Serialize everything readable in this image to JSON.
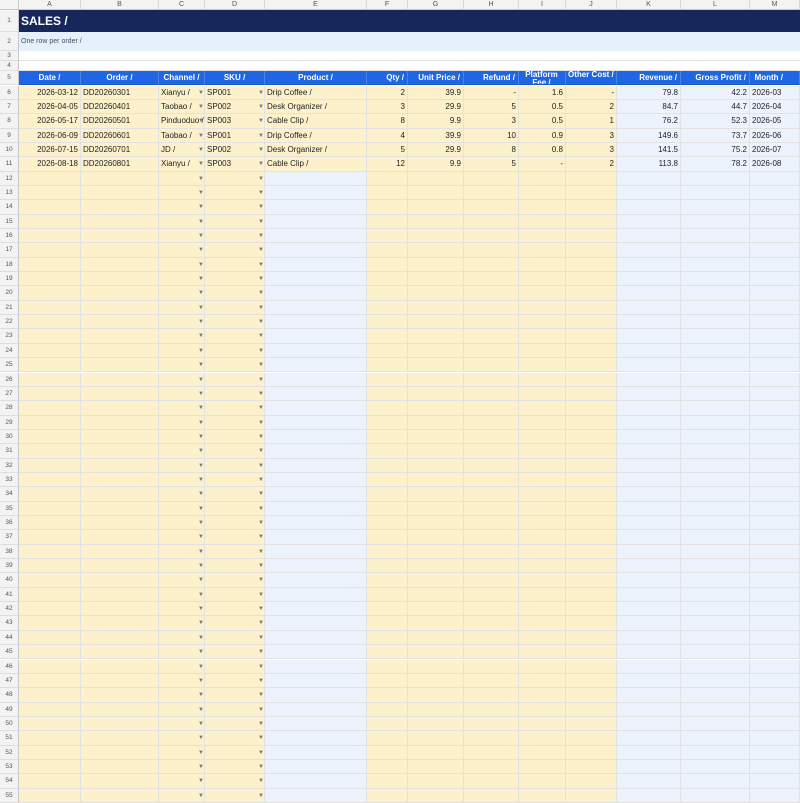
{
  "columns": [
    "A",
    "B",
    "C",
    "D",
    "E",
    "F",
    "G",
    "H",
    "I",
    "J",
    "K",
    "L",
    "M"
  ],
  "title": "SALES /",
  "subtitle": "One row per order /",
  "headers": [
    "Date /",
    "Order /",
    "Channel /",
    "SKU /",
    "Product /",
    "Qty /",
    "Unit Price /",
    "Refund /",
    "Platform Fee /",
    "Other Cost /",
    "Revenue /",
    "Gross Profit /",
    "Month /"
  ],
  "rows": [
    [
      "2026-03-12",
      "DD20260301",
      "Xianyu /",
      "SP001",
      "Drip Coffee /",
      "2",
      "39.9",
      "-",
      "1.6",
      "-",
      "79.8",
      "42.2",
      "2026-03"
    ],
    [
      "2026-04-05",
      "DD20260401",
      "Taobao /",
      "SP002",
      "Desk Organizer /",
      "3",
      "29.9",
      "5",
      "0.5",
      "2",
      "84.7",
      "44.7",
      "2026-04"
    ],
    [
      "2026-05-17",
      "DD20260501",
      "Pinduoduo /",
      "SP003",
      "Cable Clip /",
      "8",
      "9.9",
      "3",
      "0.5",
      "1",
      "76.2",
      "52.3",
      "2026-05"
    ],
    [
      "2026-06-09",
      "DD20260601",
      "Taobao /",
      "SP001",
      "Drip Coffee /",
      "4",
      "39.9",
      "10",
      "0.9",
      "3",
      "149.6",
      "73.7",
      "2026-06"
    ],
    [
      "2026-07-15",
      "DD20260701",
      "JD /",
      "SP002",
      "Desk Organizer /",
      "5",
      "29.9",
      "8",
      "0.8",
      "3",
      "141.5",
      "75.2",
      "2026-07"
    ],
    [
      "2026-08-18",
      "DD20260801",
      "Xianyu /",
      "SP003",
      "Cable Clip /",
      "12",
      "9.9",
      "5",
      "-",
      "2",
      "113.8",
      "78.2",
      "2026-08"
    ]
  ],
  "row_numbers": [
    "1",
    "2",
    "3",
    "4",
    "5",
    "6",
    "7",
    "8",
    "9",
    "10",
    "11",
    "12",
    "13",
    "14",
    "15",
    "16",
    "17",
    "18",
    "19",
    "20",
    "21",
    "22",
    "23",
    "24",
    "25",
    "26",
    "27",
    "28",
    "29",
    "30",
    "31",
    "32",
    "33",
    "34",
    "35",
    "36",
    "37",
    "38",
    "39",
    "40",
    "41",
    "42",
    "43",
    "44",
    "45",
    "46",
    "47",
    "48",
    "49",
    "50",
    "51",
    "52",
    "53",
    "54",
    "55"
  ],
  "dropdown_glyph": "▼",
  "colors": {
    "title_bg": "#17275c",
    "header_bg": "#1f66e5",
    "input_fill": "#fdf1cc",
    "calc_fill": "#edf3fd"
  }
}
